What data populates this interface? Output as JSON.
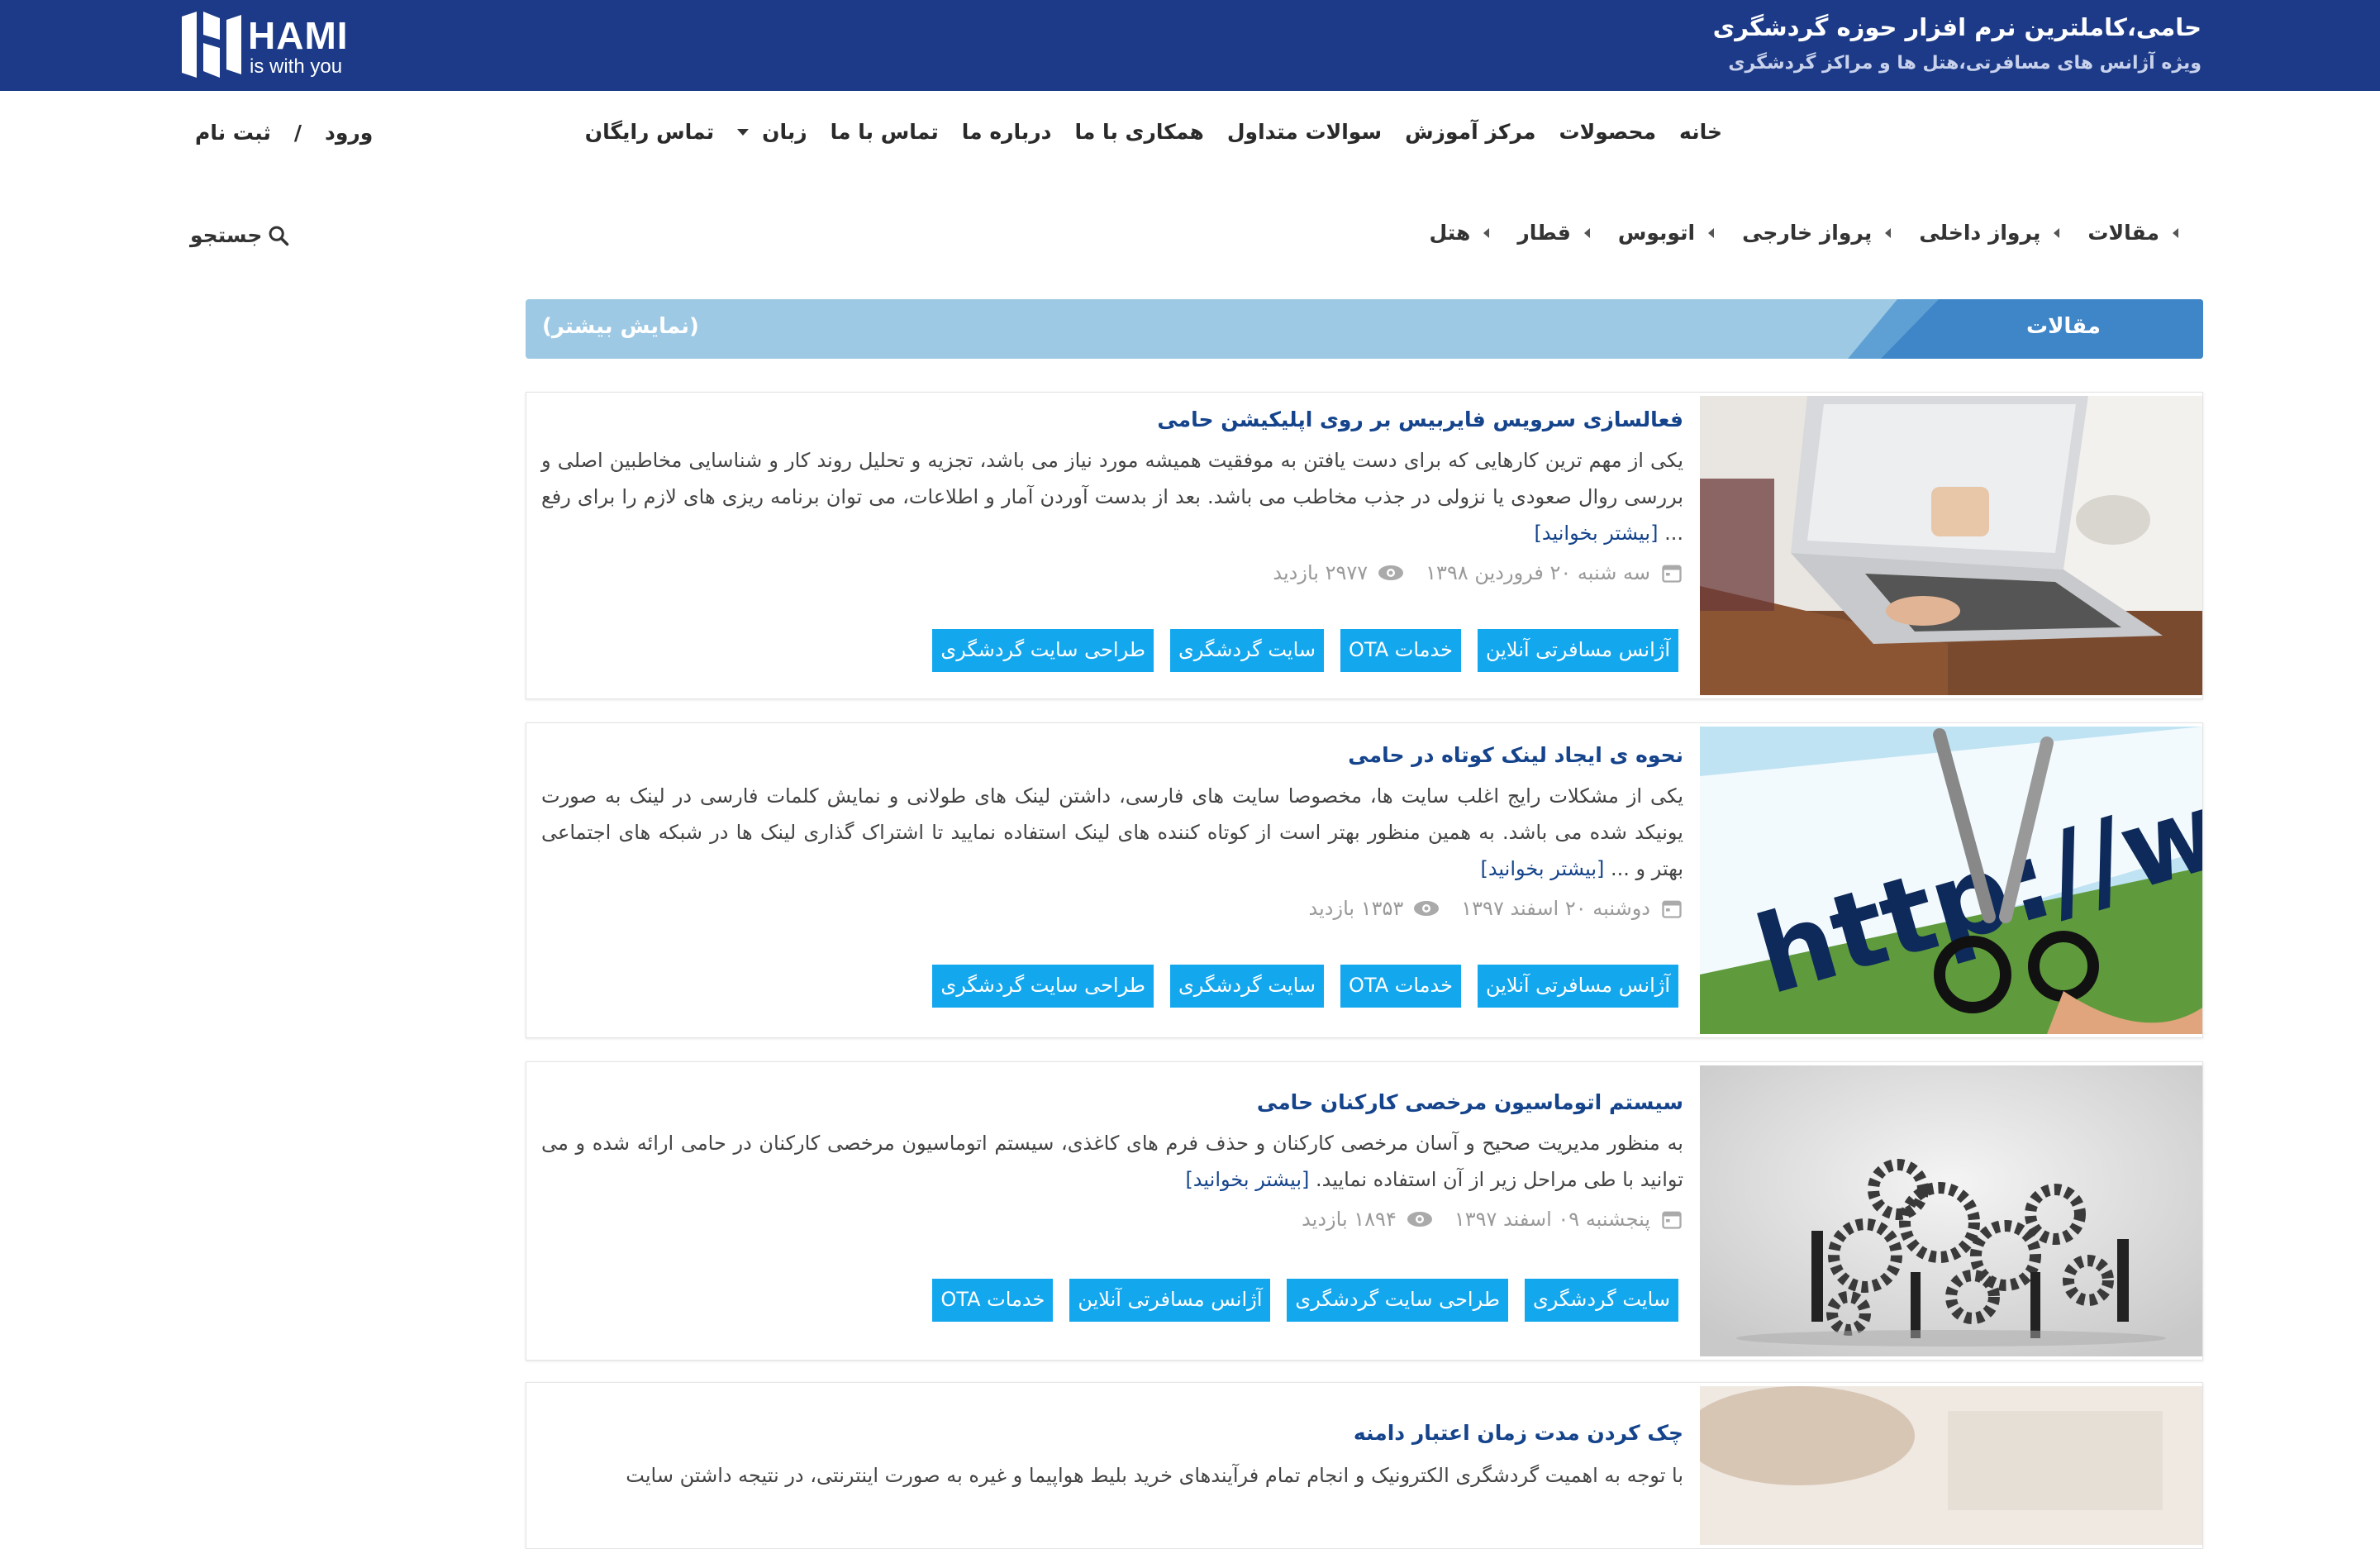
{
  "header": {
    "logo_text": "HAMI",
    "logo_tagline": "is with you",
    "title": "حامی،کاملترین نرم افزار حوزه گردشگری",
    "subtitle": "ویژه آژانس های مسافرتی،هتل ها و مراکز گردشگری",
    "bg_color": "#1c3a87"
  },
  "nav": {
    "items": [
      "خانه",
      "محصولات",
      "مرکز آموزش",
      "سوالات متداول",
      "همکاری با ما",
      "درباره ما",
      "تماس با ما"
    ],
    "language": "زبان",
    "free_call": "تماس رایگان"
  },
  "auth": {
    "login": "ورود",
    "separator": "/",
    "register": "ثبت نام"
  },
  "subnav": {
    "items": [
      "مقالات",
      "پرواز داخلی",
      "پرواز خارجی",
      "اتوبوس",
      "قطار",
      "هتل"
    ]
  },
  "search": {
    "label": "جستجو",
    "icon": "search-icon"
  },
  "section": {
    "title": "مقالات",
    "show_more": "(نمایش بیشتر)",
    "accent": "#3f86c8"
  },
  "articles": [
    {
      "title": "فعالسازی سرویس فایربیس بر روی اپلیکیشن حامی",
      "excerpt": "یکی از مهم ترین کارهایی که برای دست یافتن به موفقیت همیشه مورد نیاز می باشد، تجزیه و تحلیل روند کار و شناسایی مخاطبین اصلی و بررسی روال صعودی یا نزولی در جذب مخاطب می باشد. بعد از بدست آوردن آمار و اطلاعات، می توان برنامه ریزی های لازم را برای رفع ...",
      "read_more": "[بیشتر بخوانید]",
      "date": "سه شنبه ۲۰ فروردین ۱۳۹۸",
      "views": "۲۹۷۷ بازدید",
      "tags": [
        "آژانس مسافرتی آنلاین",
        "خدمات OTA",
        "سایت گردشگری",
        "طراحی سایت گردشگری"
      ],
      "image": "laptop-photo"
    },
    {
      "title": "نحوه ی ایجاد لینک کوتاه در حامی",
      "excerpt": "یکی از مشکلات رایج اغلب سایت ها، مخصوصا سایت های فارسی، داشتن لینک های طولانی و نمایش کلمات فارسی در لینک به صورت یونیکد شده می باشد. به همین منظور بهتر است از کوتاه کننده های لینک استفاده نمایید تا اشتراک گذاری لینک ها در شبکه های اجتماعی بهتر و ...",
      "read_more": "[بیشتر بخوانید]",
      "date": "دوشنبه ۲۰ اسفند ۱۳۹۷",
      "views": "۱۳۵۳ بازدید",
      "tags": [
        "آژانس مسافرتی آنلاین",
        "خدمات OTA",
        "سایت گردشگری",
        "طراحی سایت گردشگری"
      ],
      "image": "http-scissors-photo"
    },
    {
      "title": "سیستم اتوماسیون مرخصی کارکنان حامی",
      "excerpt": "به منظور مدیریت صحیح و آسان مرخصی کارکنان و حذف فرم های کاغذی، سیستم اتوماسیون مرخصی کارکنان در حامی ارائه شده و می توانید با طی مراحل زیر از آن استفاده نمایید.",
      "read_more": "[بیشتر بخوانید]",
      "date": "پنجشنبه ۰۹ اسفند ۱۳۹۷",
      "views": "۱۸۹۴ بازدید",
      "tags": [
        "سایت گردشگری",
        "طراحی سایت گردشگری",
        "آژانس مسافرتی آنلاین",
        "خدمات OTA"
      ],
      "image": "gears-team-photo"
    },
    {
      "title": "چک کردن مدت زمان اعتبار دامنه",
      "excerpt": "با توجه به اهمیت گردشگری الکترونیک و انجام تمام فرآیندهای خرید بلیط هواپیما و غیره به صورت اینترنتی، در نتیجه داشتن سایت",
      "image": "desk-photo"
    }
  ]
}
